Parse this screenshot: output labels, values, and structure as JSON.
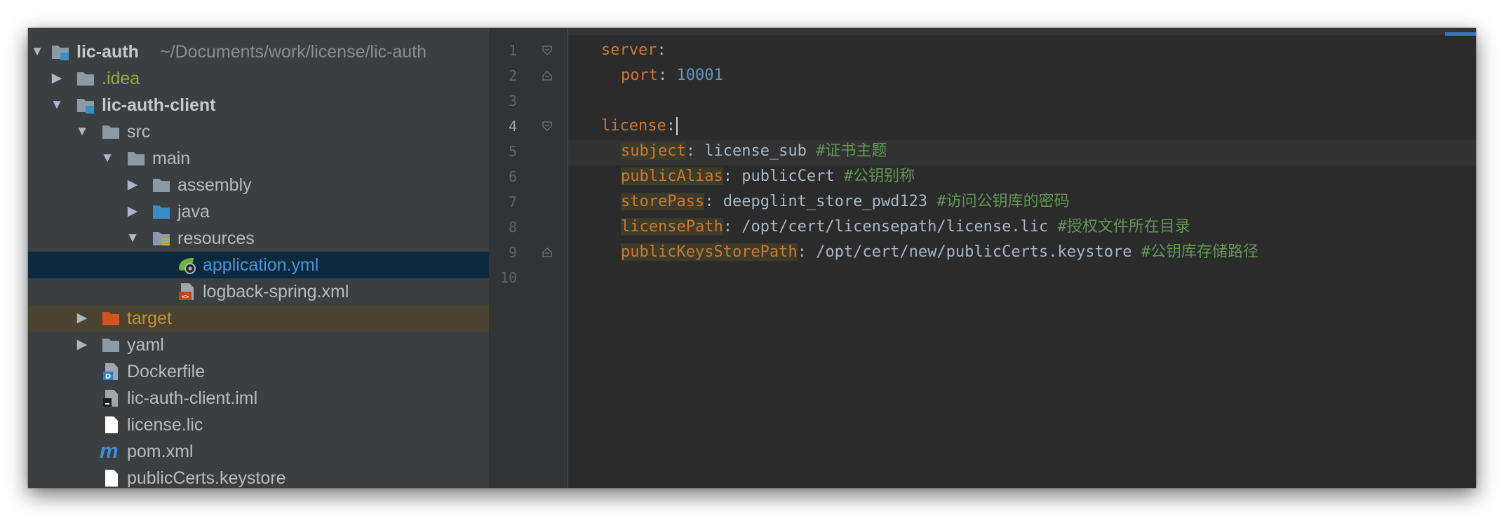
{
  "project_tree": {
    "root": {
      "name": "lic-auth",
      "path": "~/Documents/work/license/lic-auth"
    },
    "items": [
      {
        "label": ".idea"
      },
      {
        "label": "lic-auth-client"
      },
      {
        "label": "src"
      },
      {
        "label": "main"
      },
      {
        "label": "assembly"
      },
      {
        "label": "java"
      },
      {
        "label": "resources"
      },
      {
        "label": "application.yml"
      },
      {
        "label": "logback-spring.xml"
      },
      {
        "label": "target"
      },
      {
        "label": "yaml"
      },
      {
        "label": "Dockerfile"
      },
      {
        "label": "lic-auth-client.iml"
      },
      {
        "label": "license.lic"
      },
      {
        "label": "pom.xml"
      },
      {
        "label": "publicCerts.keystore"
      }
    ],
    "maven_icon_glyph": "m",
    "docker_icon_glyph": "D",
    "xml_icon_glyph": "<>"
  },
  "editor": {
    "file": "application.yml",
    "current_line": 4,
    "line_numbers": [
      "1",
      "2",
      "3",
      "4",
      "5",
      "6",
      "7",
      "8",
      "9",
      "10"
    ],
    "lines": [
      {
        "key": "server",
        "sep": ":"
      },
      {
        "key": "port",
        "sep": ": ",
        "value": "10001"
      },
      {},
      {
        "key": "license",
        "sep": ":"
      },
      {
        "key": "subject",
        "sep": ": ",
        "value": "license_sub",
        "comment": "#证书主题"
      },
      {
        "key": "publicAlias",
        "sep": ": ",
        "value": "publicCert",
        "comment": "#公钥别称"
      },
      {
        "key": "storePass",
        "sep": ": ",
        "value": "deepglint_store_pwd123",
        "comment": "#访问公钥库的密码"
      },
      {
        "key": "licensePath",
        "sep": ": ",
        "value": "/opt/cert/licensepath/license.lic",
        "comment": "#授权文件所在目录"
      },
      {
        "key": "publicKeysStorePath",
        "sep": ": ",
        "value": "/opt/cert/new/publicCerts.keystore",
        "comment": "#公钥库存储路径"
      },
      {}
    ]
  },
  "colors": {
    "tree_bg": "#3c3f41",
    "editor_bg": "#2b2b2b",
    "selection": "#0d293e",
    "excluded": "#49432f",
    "keyword": "#cc7832",
    "number": "#6897bb",
    "comment": "#629755"
  }
}
